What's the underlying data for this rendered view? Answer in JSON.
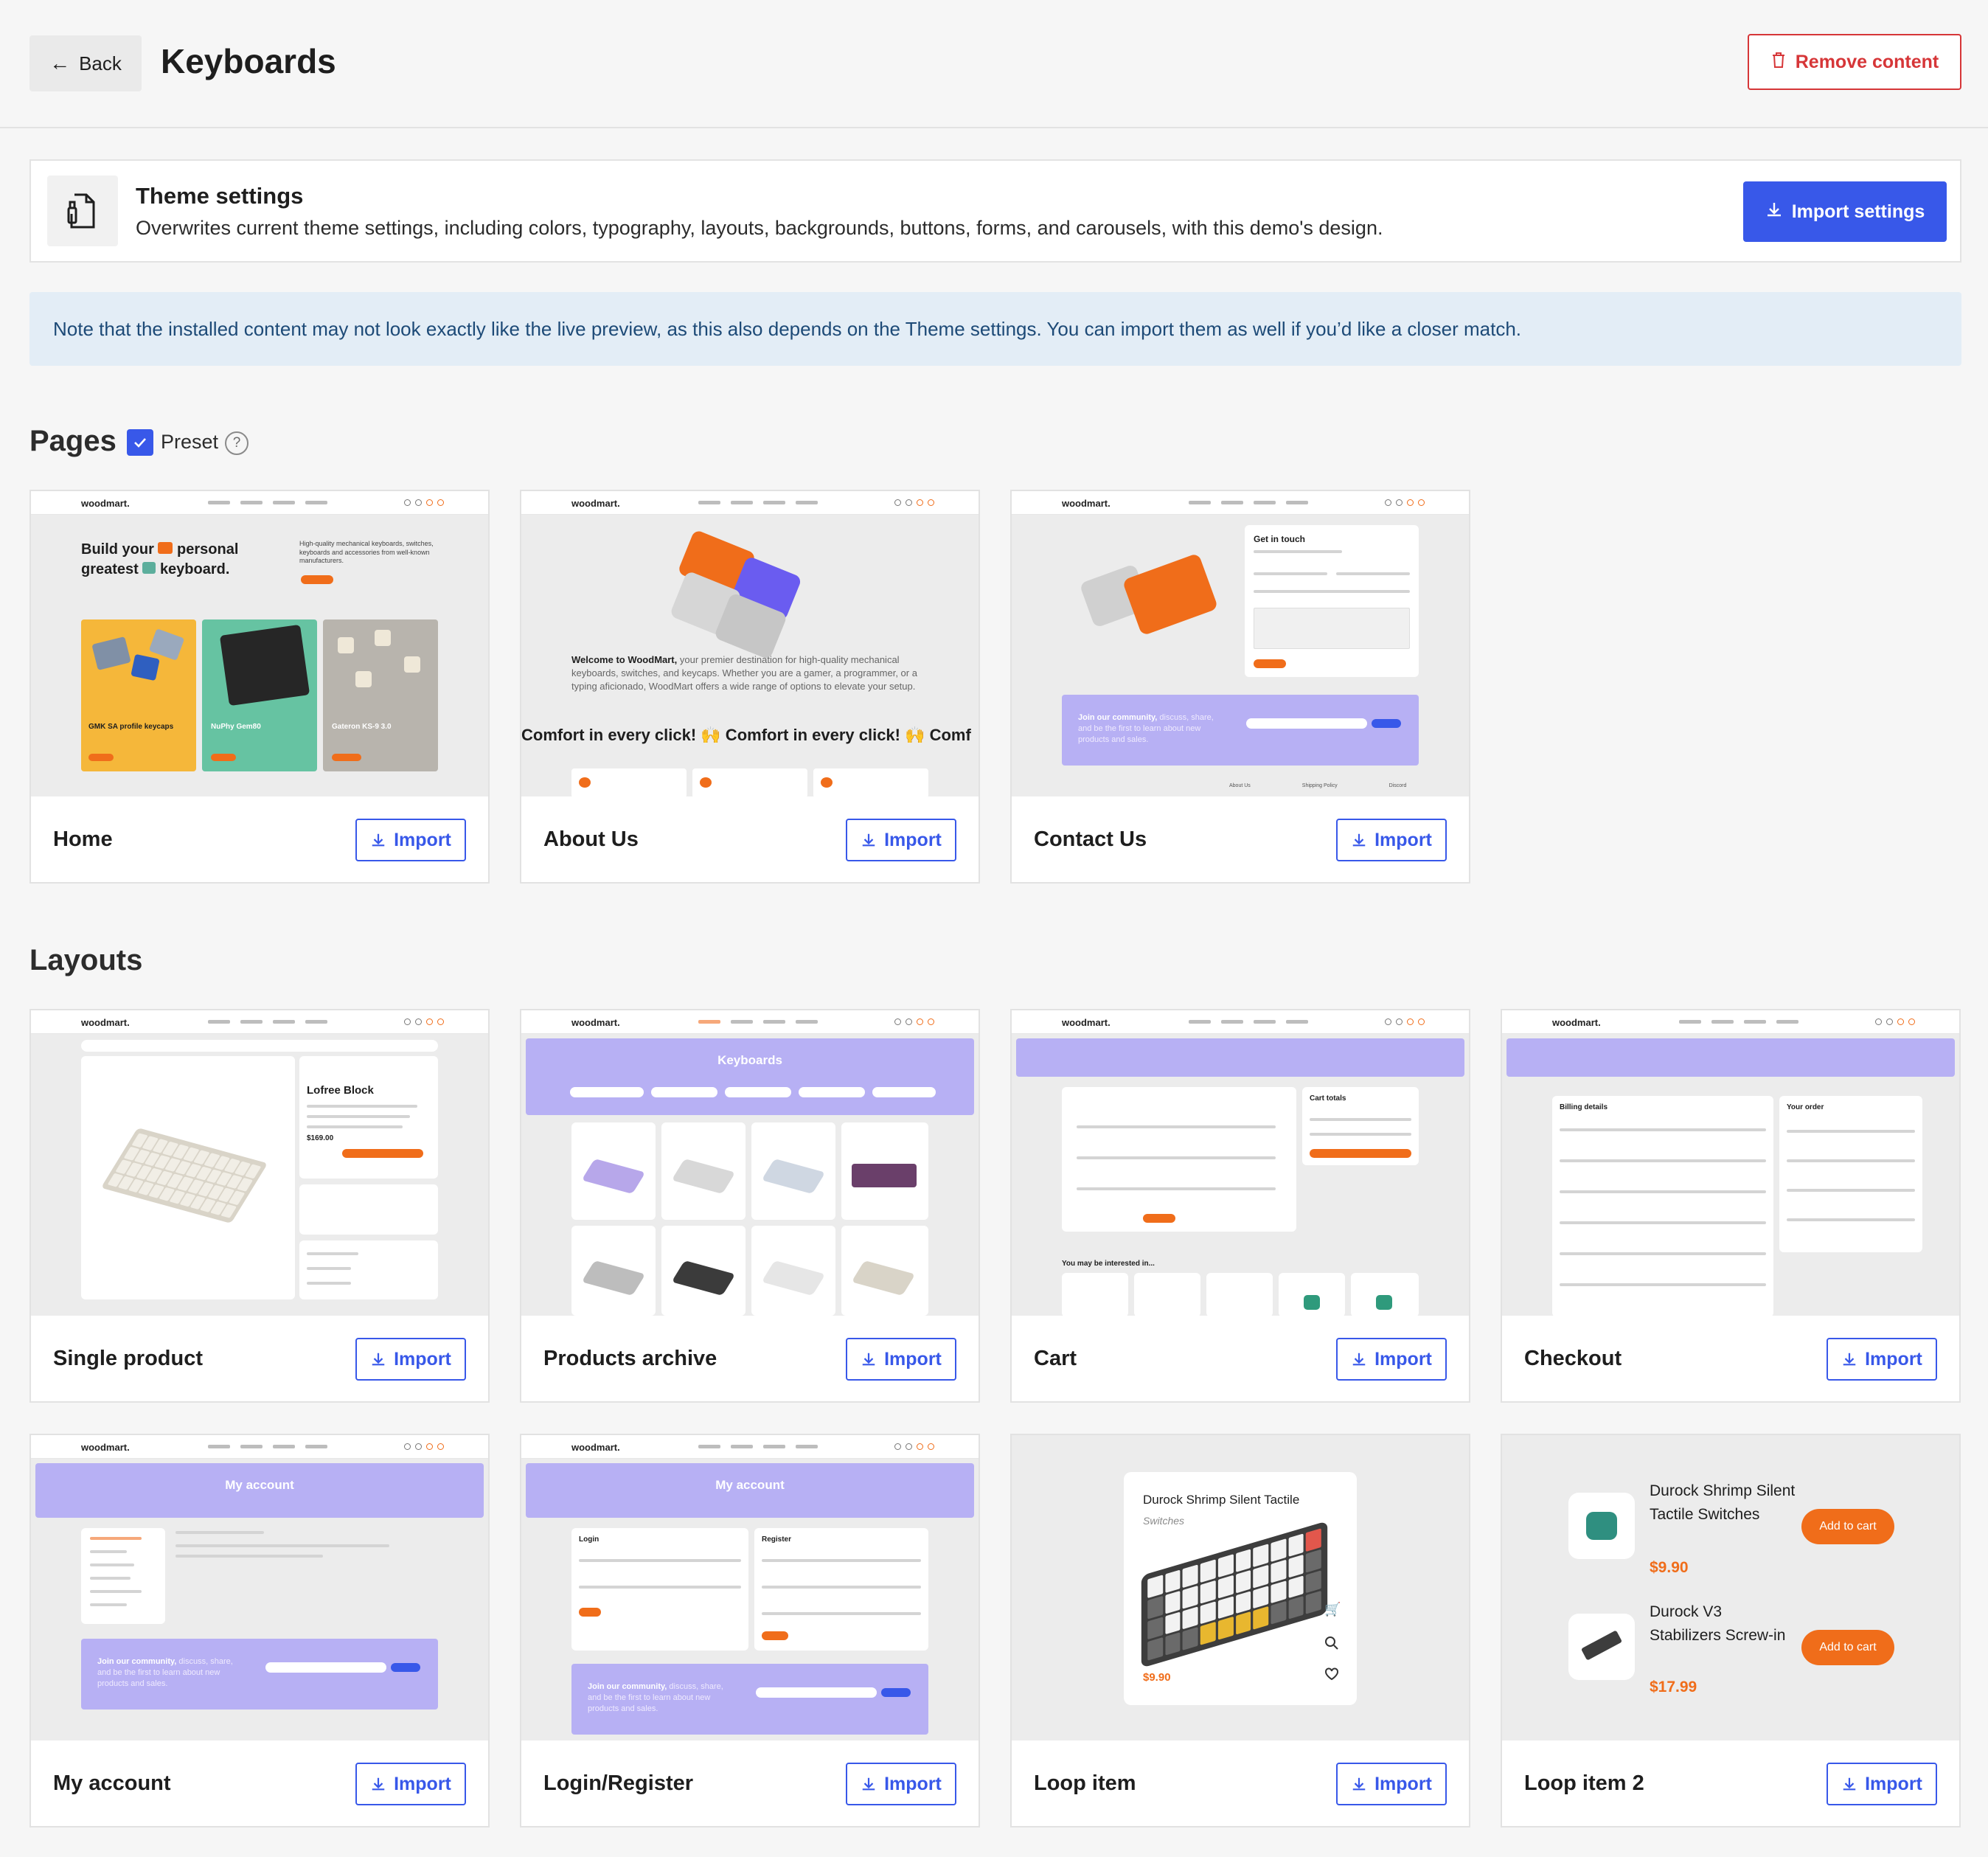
{
  "header": {
    "back_label": "Back",
    "title": "Keyboards",
    "remove_label": "Remove content"
  },
  "theme_settings": {
    "title": "Theme settings",
    "description": "Overwrites current theme settings, including colors, typography, layouts, backgrounds, buttons, forms, and carousels, with this demo's design.",
    "button_label": "Import settings"
  },
  "notice": "Note that the installed content may not look exactly like the live preview, as this also depends on the Theme settings. You can import them as well if you’d like a closer match.",
  "pages": {
    "heading": "Pages",
    "preset_label": "Preset",
    "preset_checked": true,
    "help": "?",
    "items": [
      {
        "name": "Home",
        "import_label": "Import"
      },
      {
        "name": "About Us",
        "import_label": "Import"
      },
      {
        "name": "Contact Us",
        "import_label": "Import"
      }
    ]
  },
  "layouts": {
    "heading": "Layouts",
    "items": [
      {
        "name": "Single product",
        "import_label": "Import"
      },
      {
        "name": "Products archive",
        "import_label": "Import"
      },
      {
        "name": "Cart",
        "import_label": "Import"
      },
      {
        "name": "Checkout",
        "import_label": "Import"
      },
      {
        "name": "My account",
        "import_label": "Import"
      },
      {
        "name": "Login/Register",
        "import_label": "Import"
      },
      {
        "name": "Loop item",
        "import_label": "Import"
      },
      {
        "name": "Loop item 2",
        "import_label": "Import"
      }
    ]
  },
  "previews": {
    "logo": "woodmart.",
    "home": {
      "headline_1": "Build your",
      "headline_2": "personal",
      "headline_3": "greatest",
      "headline_4": "keyboard.",
      "tagline": "High-quality mechanical keyboards, switches, keyboards and accessories from well-known manufacturers.",
      "tiles": [
        "GMK SA profile keycaps",
        "NuPhy Gem80",
        "Gateron KS-9 3.0"
      ]
    },
    "about": {
      "welcome_bold": "Welcome to WoodMart,",
      "welcome_rest": " your premier destination for high-quality mechanical keyboards, switches, and keycaps. Whether you are a gamer, a programmer, or a typing aficionado, WoodMart offers a wide range of options to elevate your setup.",
      "marquee": "Comfort in every click! 🙌 Comfort in every click! 🙌 Comf"
    },
    "contact": {
      "form_title": "Get in touch",
      "community_bold": "Join our community,",
      "community_rest": " discuss, share, and be the first to learn about new products and sales.",
      "footer_links": [
        "About Us",
        "Shipping Policy",
        "Discord"
      ]
    },
    "single_product": {
      "product_name": "Lofree Block",
      "price": "$169.00"
    },
    "archive": {
      "title": "Keyboards"
    },
    "cart": {
      "totals_title": "Cart totals",
      "interest": "You may be interested in..."
    },
    "checkout": {
      "billing": "Billing details",
      "order": "Your order"
    },
    "my_account": {
      "title": "My account",
      "community_bold": "Join our community,",
      "community_rest": " discuss, share, and be the first to learn about new products and sales."
    },
    "login": {
      "title": "My account",
      "login": "Login",
      "register": "Register",
      "community_bold": "Join our community,",
      "community_rest": " discuss, share, and be the first to learn about new products and sales."
    },
    "loop_item": {
      "name": "Durock Shrimp Silent Tactile",
      "category": "Switches",
      "price": "$9.90"
    },
    "loop_item2": {
      "items": [
        {
          "name": "Durock Shrimp Silent Tactile Switches",
          "price": "$9.90",
          "button": "Add to cart"
        },
        {
          "name": "Durock V3 Stabilizers Screw-in",
          "price": "$17.99",
          "button": "Add to cart"
        }
      ]
    }
  },
  "colors": {
    "accent_blue": "#3858e9",
    "danger_red": "#d63638",
    "brand_orange": "#f06d1a",
    "preview_purple": "#b7b0f4",
    "notice_bg": "#e3edf6"
  }
}
